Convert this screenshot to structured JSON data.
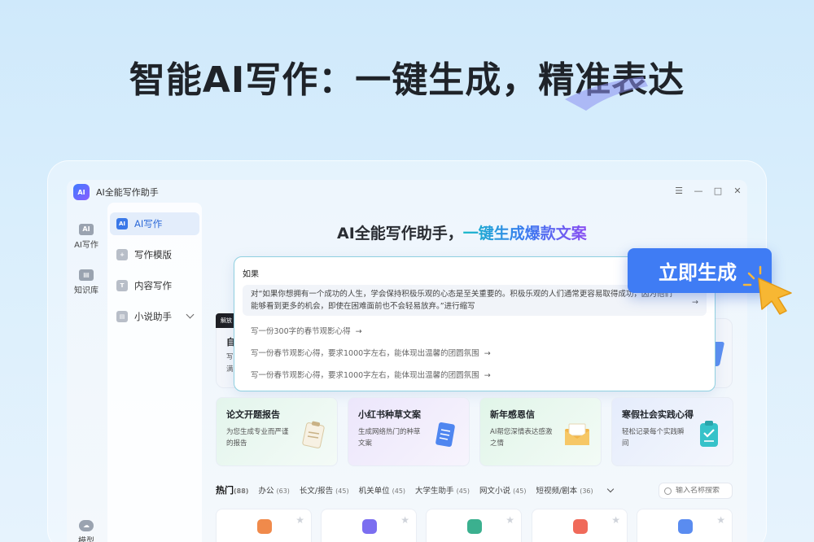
{
  "hero": {
    "title": "智能AI写作：一键生成，精准表达"
  },
  "window": {
    "title": "AI全能写作助手",
    "controls": [
      "☰",
      "—",
      "□",
      "✕"
    ]
  },
  "rail": {
    "items": [
      {
        "label": "AI写作",
        "icon": "ai-icon"
      },
      {
        "label": "知识库",
        "icon": "book-icon"
      },
      {
        "label": "模型",
        "icon": "cloud-icon"
      }
    ]
  },
  "sidebar": {
    "items": [
      {
        "label": "AI写作",
        "active": true
      },
      {
        "label": "写作模版"
      },
      {
        "label": "内容写作"
      },
      {
        "label": "小说助手"
      }
    ]
  },
  "main": {
    "heading_prefix": "AI全能写作助手，",
    "heading_highlight": "一键生成爆款文案",
    "prompt_value": "如果",
    "suggestions": [
      "对“如果你想拥有一个成功的人生，学会保持积极乐观的心态是至关重要的。积极乐观的人们通常更容易取得成功，因为他们能够看到更多的机会，即使在困难面前也不会轻易放弃。”进行缩写",
      "写一份300字的春节观影心得",
      "写一份春节观影心得，要求1000字左右，能体现出温馨的团圆氛围",
      "写一份春节观影心得，要求1000字左右，能体现出温馨的团圆氛围"
    ],
    "partial_card": {
      "badge": "解放",
      "title": "自",
      "line1": "写",
      "line2": "满"
    },
    "generate_button": "立即生成",
    "feature_cards": [
      {
        "title": "论文开题报告",
        "desc": "为您生成专业而严谨的报告",
        "bg": "#e6f6ef",
        "icon": "clipboard-icon"
      },
      {
        "title": "小红书种草文案",
        "desc": "生成网络热门的种草文案",
        "bg": "#efeafb",
        "icon": "document-icon"
      },
      {
        "title": "新年感恩信",
        "desc": "AI帮您深情表达感激之情",
        "bg": "#e7f7ee",
        "icon": "envelope-icon"
      },
      {
        "title": "寒假社会实践心得",
        "desc": "轻松记录每个实践瞬间",
        "bg": "#e9effc",
        "icon": "checklist-icon"
      }
    ],
    "tabs": [
      {
        "label": "热门",
        "count": "(88)",
        "active": true
      },
      {
        "label": "办公",
        "count": "(63)"
      },
      {
        "label": "长文/报告",
        "count": "(45)"
      },
      {
        "label": "机关单位",
        "count": "(45)"
      },
      {
        "label": "大学生助手",
        "count": "(45)"
      },
      {
        "label": "网文小说",
        "count": "(45)"
      },
      {
        "label": "短视频/剧本",
        "count": "(36)"
      }
    ],
    "search_placeholder": "输入名称搜索",
    "template_cards": [
      {
        "icon_color": "#f08a4b"
      },
      {
        "icon_color": "#7b6ef0"
      },
      {
        "icon_color": "#3bb08f"
      },
      {
        "icon_color": "#f06a5a"
      },
      {
        "icon_color": "#5a8cf0"
      }
    ]
  }
}
